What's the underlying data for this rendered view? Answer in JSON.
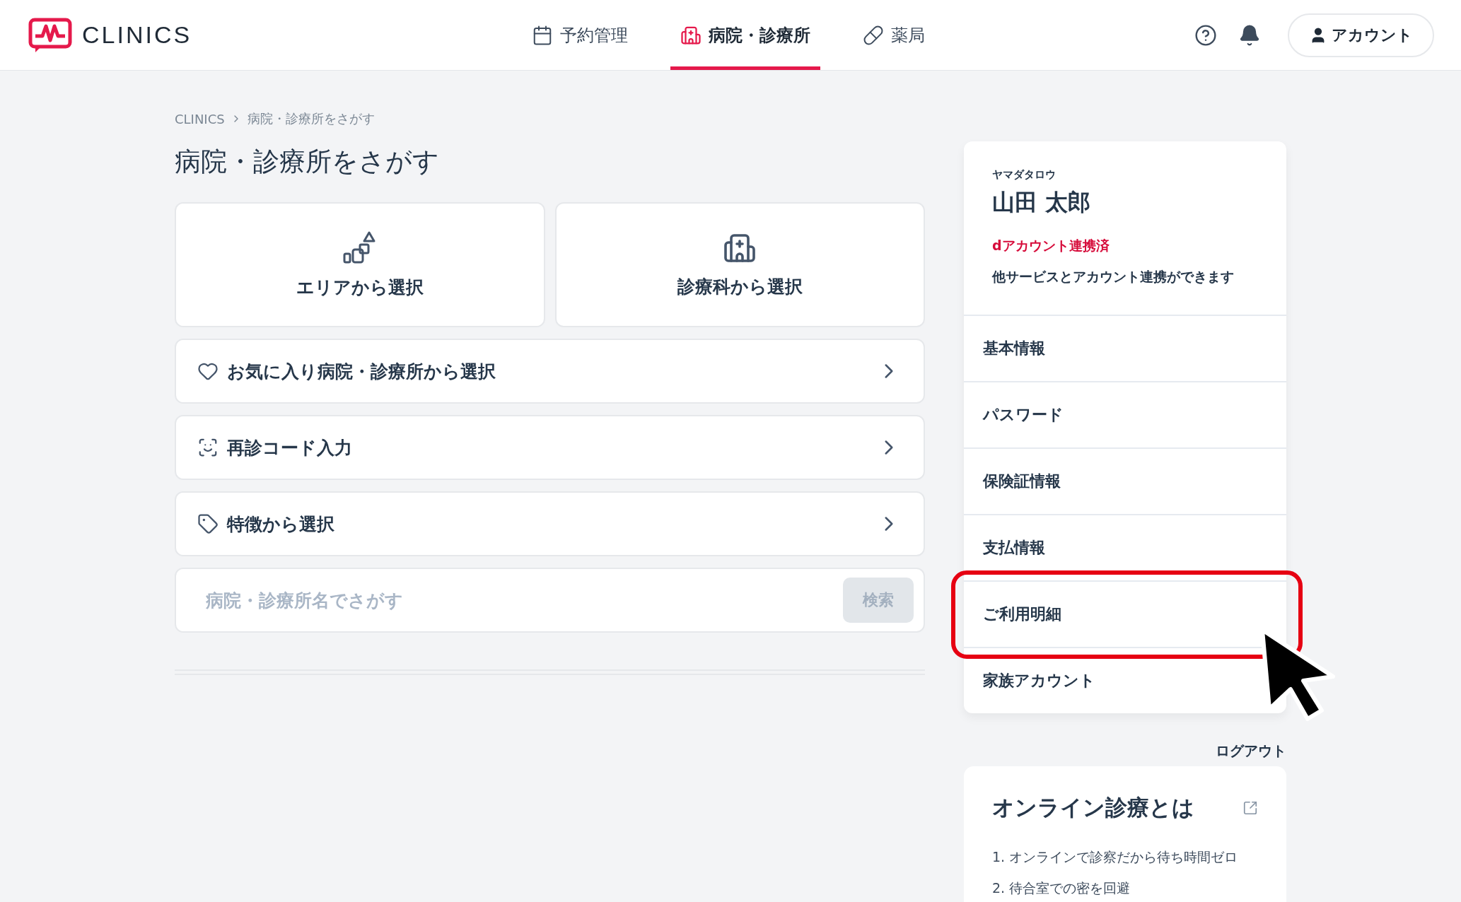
{
  "header": {
    "logo_text": "CLINICS",
    "nav": [
      {
        "label": "予約管理",
        "kind": "calendar",
        "selected": false
      },
      {
        "label": "病院・診療所",
        "kind": "hospital",
        "selected": true
      },
      {
        "label": "薬局",
        "kind": "pill",
        "selected": false
      }
    ],
    "account_button": "アカウント"
  },
  "breadcrumb": [
    "CLINICS",
    "病院・診療所をさがす"
  ],
  "page_title": "病院・診療所をさがす",
  "tiles": [
    {
      "label": "エリアから選択",
      "kind": "area"
    },
    {
      "label": "診療科から選択",
      "kind": "department"
    }
  ],
  "options": [
    {
      "label": "お気に入り病院・診療所から選択",
      "kind": "favorite"
    },
    {
      "label": "再診コード入力",
      "kind": "code"
    },
    {
      "label": "特徴から選択",
      "kind": "feature"
    }
  ],
  "search": {
    "placeholder": "病院・診療所名でさがす",
    "button": "検索"
  },
  "profile": {
    "kana": "ヤマダタロウ",
    "name": "山田 太郎",
    "link_status": "dアカウント連携済",
    "link_note": "他サービスとアカウント連携ができます"
  },
  "menu": [
    {
      "label": "基本情報",
      "highlighted": false
    },
    {
      "label": "パスワード",
      "highlighted": false
    },
    {
      "label": "保険証情報",
      "highlighted": false
    },
    {
      "label": "支払情報",
      "highlighted": false
    },
    {
      "label": "ご利用明細",
      "highlighted": true
    },
    {
      "label": "家族アカウント",
      "highlighted": false
    }
  ],
  "logout": "ログアウト",
  "info_card": {
    "title": "オンライン診療とは",
    "items": [
      "1. オンラインで診察だから待ち時間ゼロ",
      "2. 待合室での密を回避"
    ]
  }
}
